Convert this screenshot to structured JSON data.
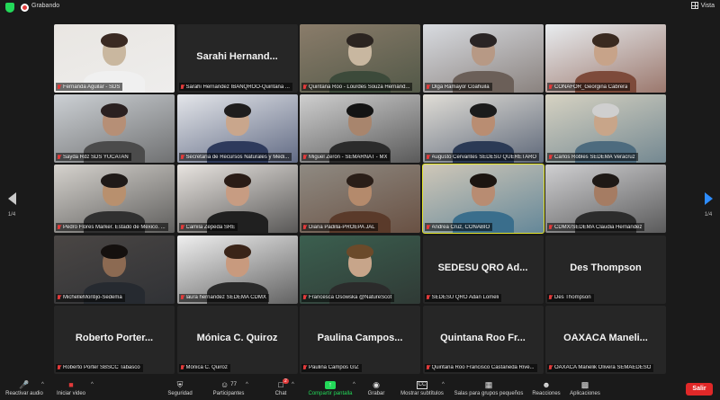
{
  "topbar": {
    "recording_label": "Grabando",
    "view_label": "Vista"
  },
  "nav": {
    "left_page": "1/4",
    "right_page": "1/4"
  },
  "tiles": [
    {
      "name": "Fernanda Aguilar - SDS",
      "big": "",
      "video": true
    },
    {
      "name": "Sarahi Hernandez IBANQROO-Quintana ...",
      "big": "Sarahi Hernand...",
      "video": false
    },
    {
      "name": "Quintana Roo - Lourdes Souza Hernánd...",
      "big": "",
      "video": true
    },
    {
      "name": "Olga Ramayor Coahuila",
      "big": "",
      "video": true
    },
    {
      "name": "CONAFOR_Georgina Cabrera",
      "big": "",
      "video": true
    },
    {
      "name": "Sayda Rdz SDS YUCATAN",
      "big": "",
      "video": true
    },
    {
      "name": "Secretaría de Recursos Naturales y Medi...",
      "big": "",
      "video": true
    },
    {
      "name": "Miguel Zerón - SEMARNAT - MX",
      "big": "",
      "video": true
    },
    {
      "name": "Augusto Cervantes SEDESU QUERETARO",
      "big": "",
      "video": true
    },
    {
      "name": "Carlos Robles SEDEMA Veracruz",
      "big": "",
      "video": true
    },
    {
      "name": "Pedro Flores Marker. Estado de México. ...",
      "big": "",
      "video": true
    },
    {
      "name": "Camila Zepeda SRE",
      "big": "",
      "video": true
    },
    {
      "name": "Diana Padilla-PROEPA JAL",
      "big": "",
      "video": true
    },
    {
      "name": "Andrea Cruz, CONABIO",
      "big": "",
      "video": true
    },
    {
      "name": "CDMX/SEDEMA Claudia Hernández",
      "big": "",
      "video": true
    },
    {
      "name": "MichelleMontijo-Sedema",
      "big": "",
      "video": true
    },
    {
      "name": "laura hernandez SEDEMA CDMX",
      "big": "",
      "video": true
    },
    {
      "name": "Francesca Osowska @NatureScot",
      "big": "",
      "video": true
    },
    {
      "name": "SEDESU QRO Adan Lomeli",
      "big": "SEDESU QRO Ad...",
      "video": false
    },
    {
      "name": "Des Thompson",
      "big": "Des Thompson",
      "video": false
    },
    {
      "name": "Roberto Porter SBSCC Tabasco",
      "big": "Roberto Porter...",
      "video": false
    },
    {
      "name": "Mónica C. Quiroz",
      "big": "Mónica C. Quiroz",
      "video": false
    },
    {
      "name": "Paulina Campos GIZ",
      "big": "Paulina Campos...",
      "video": false
    },
    {
      "name": "Quintana Roo Francisco Castañeda Rive...",
      "big": "Quintana Roo Fr...",
      "video": false
    },
    {
      "name": "OAXACA Manelik Olivera SEMAEDESO",
      "big": "OAXACA Maneli...",
      "video": false
    }
  ],
  "toolbar": {
    "audio": "Reactivar audio",
    "video": "Iniciar video",
    "security": "Seguridad",
    "participants": "Participantes",
    "participants_count": "77",
    "chat": "Chat",
    "chat_badge": "2",
    "share": "Compartir pantalla",
    "record": "Grabar",
    "subtitles": "Mostrar subtítulos",
    "rooms": "Salas para grupos pequeños",
    "reactions": "Reacciones",
    "apps": "Aplicaciones",
    "leave": "Salir"
  },
  "colors": {
    "accent_blue": "#2d8cff",
    "active_speaker": "#e6e62c",
    "leave_red": "#e02828",
    "share_green": "#23d959"
  }
}
